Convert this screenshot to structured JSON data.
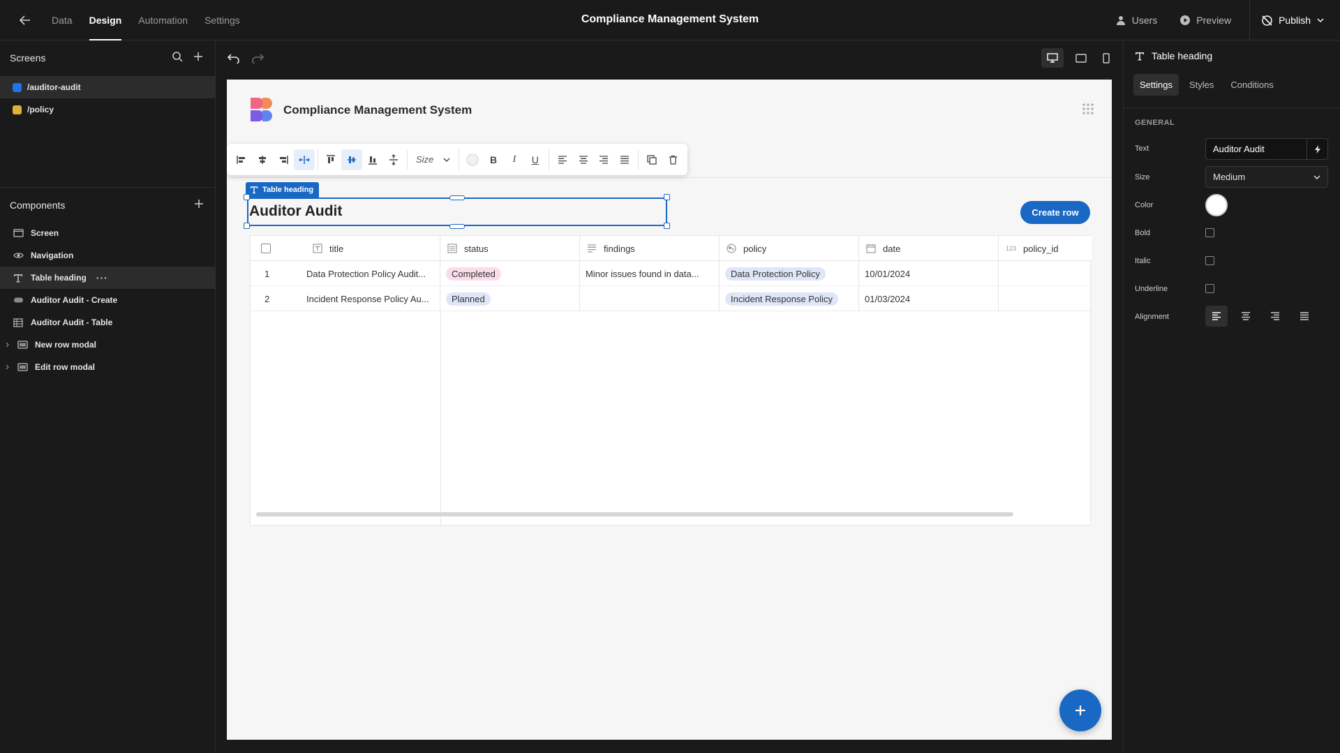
{
  "topbar": {
    "tabs": [
      "Data",
      "Design",
      "Automation",
      "Settings"
    ],
    "active_tab": "Design",
    "title": "Compliance Management System",
    "users": "Users",
    "preview": "Preview",
    "publish": "Publish"
  },
  "screens": {
    "header": "Screens",
    "items": [
      {
        "label": "/auditor-audit",
        "color": "#1e74e8"
      },
      {
        "label": "/policy",
        "color": "#e0b23a"
      }
    ]
  },
  "components": {
    "header": "Components",
    "items": [
      {
        "label": "Screen",
        "icon": "screen-icon"
      },
      {
        "label": "Navigation",
        "icon": "eye-icon"
      },
      {
        "label": "Table heading",
        "icon": "text-icon",
        "selected": true
      },
      {
        "label": "Auditor Audit - Create",
        "icon": "button-icon"
      },
      {
        "label": "Auditor Audit - Table",
        "icon": "table-icon"
      },
      {
        "label": "New row modal",
        "icon": "modal-icon"
      },
      {
        "label": "Edit row modal",
        "icon": "modal-icon"
      }
    ]
  },
  "canvas": {
    "app_title": "Compliance Management System",
    "component_tag": "Table heading",
    "heading": "Auditor Audit",
    "size_placeholder": "Size",
    "create_button": "Create row",
    "table": {
      "columns": [
        "title",
        "status",
        "findings",
        "policy",
        "date",
        "policy_id"
      ],
      "rows": [
        {
          "num": "1",
          "title": "Data Protection Policy Audit...",
          "status": "Completed",
          "findings": "Minor issues found in data...",
          "policy": "Data Protection Policy",
          "date": "10/01/2024",
          "policy_id": ""
        },
        {
          "num": "2",
          "title": "Incident Response Policy Au...",
          "status": "Planned",
          "findings": "",
          "policy": "Incident Response Policy",
          "date": "01/03/2024",
          "policy_id": ""
        }
      ],
      "id_badge": "123"
    }
  },
  "settings_panel": {
    "title": "Table heading",
    "tabs": [
      "Settings",
      "Styles",
      "Conditions"
    ],
    "active_tab": "Settings",
    "section": "GENERAL",
    "text_label": "Text",
    "text_value": "Auditor Audit",
    "size_label": "Size",
    "size_value": "Medium",
    "color_label": "Color",
    "bold_label": "Bold",
    "italic_label": "Italic",
    "underline_label": "Underline",
    "alignment_label": "Alignment"
  },
  "colors": {
    "accent": "#1968c4",
    "completed_pill": "#fbdcea",
    "planned_pill": "#dfe6f7",
    "policy_pill": "#dfe6f7"
  }
}
